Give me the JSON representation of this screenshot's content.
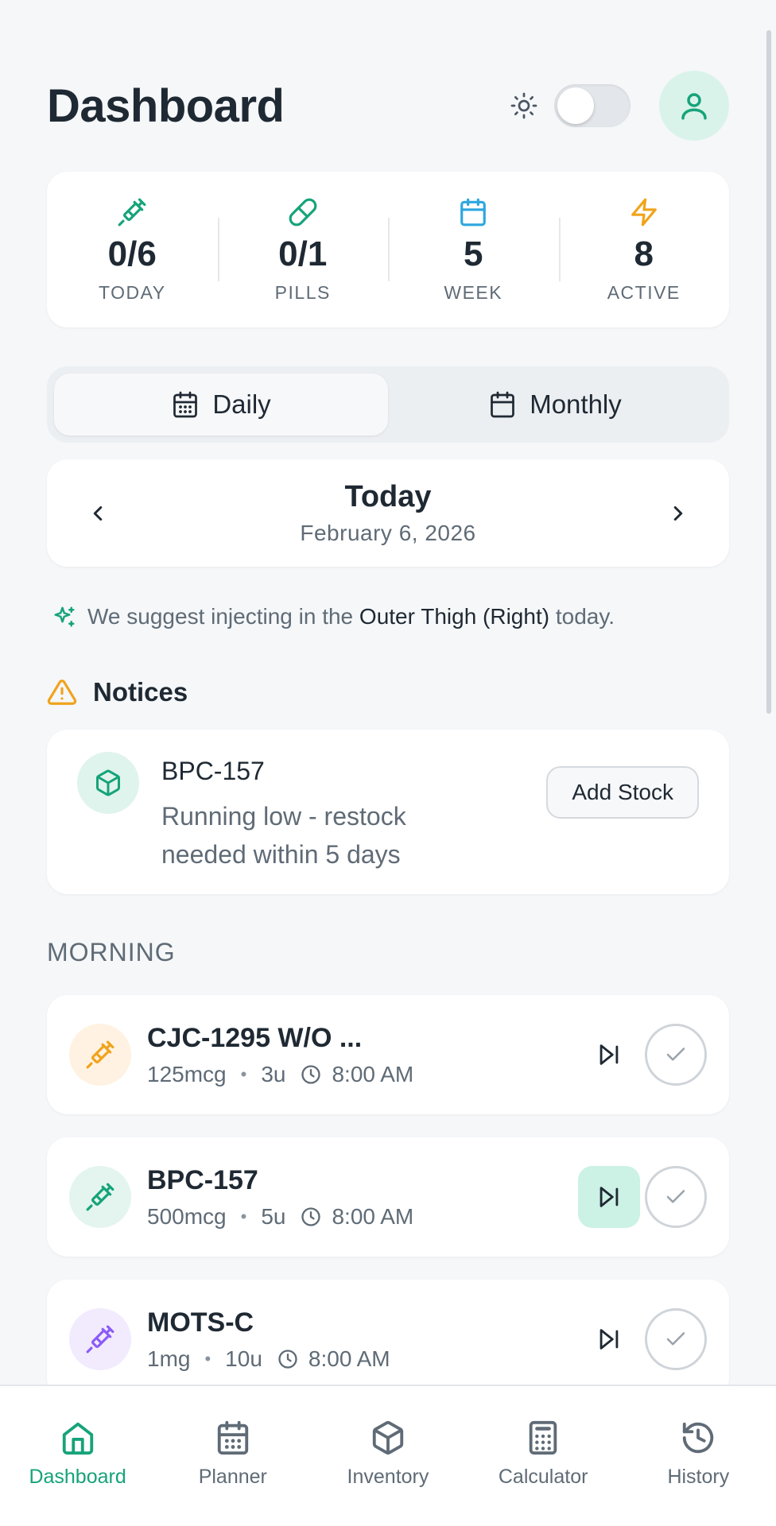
{
  "colors": {
    "accent": "#16a37a",
    "warning": "#f0a31b",
    "info": "#2ea6de",
    "purple": "#8b5cf6",
    "text_primary": "#1f2933",
    "text_secondary": "#5f6b76"
  },
  "header": {
    "title": "Dashboard",
    "theme_icon": "sun-icon",
    "profile_icon": "user-icon"
  },
  "stats": [
    {
      "value": "0/6",
      "label": "TODAY",
      "icon": "syringe-icon"
    },
    {
      "value": "0/1",
      "label": "PILLS",
      "icon": "pill-icon"
    },
    {
      "value": "5",
      "label": "WEEK",
      "icon": "calendar-icon"
    },
    {
      "value": "8",
      "label": "ACTIVE",
      "icon": "lightning-icon"
    }
  ],
  "view_toggle": {
    "daily": "Daily",
    "monthly": "Monthly",
    "selected": "Daily"
  },
  "date_nav": {
    "title": "Today",
    "date": "February 6, 2026"
  },
  "suggestion": {
    "prefix": "We suggest injecting in the",
    "site": "Outer Thigh (Right)",
    "suffix": "today."
  },
  "notices": {
    "title": "Notices",
    "items": [
      {
        "name": "BPC-157",
        "message": "Running low - restock needed within 5 days",
        "action": "Add Stock"
      }
    ]
  },
  "schedule": {
    "section": "MORNING",
    "doses": [
      {
        "name": "CJC-1295 W/O ...",
        "amount": "125mcg",
        "units": "3u",
        "time": "8:00 AM",
        "color": "#f0a31b",
        "bg": "#fff2e2"
      },
      {
        "name": "BPC-157",
        "amount": "500mcg",
        "units": "5u",
        "time": "8:00 AM",
        "color": "#16a37a",
        "bg": "#e3f5ee"
      },
      {
        "name": "MOTS-C",
        "amount": "1mg",
        "units": "10u",
        "time": "8:00 AM",
        "color": "#8b5cf6",
        "bg": "#f1ebfd"
      }
    ]
  },
  "bottom_nav": [
    {
      "label": "Dashboard",
      "icon": "home-icon",
      "active": true
    },
    {
      "label": "Planner",
      "icon": "calendar-icon",
      "active": false
    },
    {
      "label": "Inventory",
      "icon": "box-icon",
      "active": false
    },
    {
      "label": "Calculator",
      "icon": "calculator-icon",
      "active": false
    },
    {
      "label": "History",
      "icon": "history-icon",
      "active": false
    }
  ]
}
